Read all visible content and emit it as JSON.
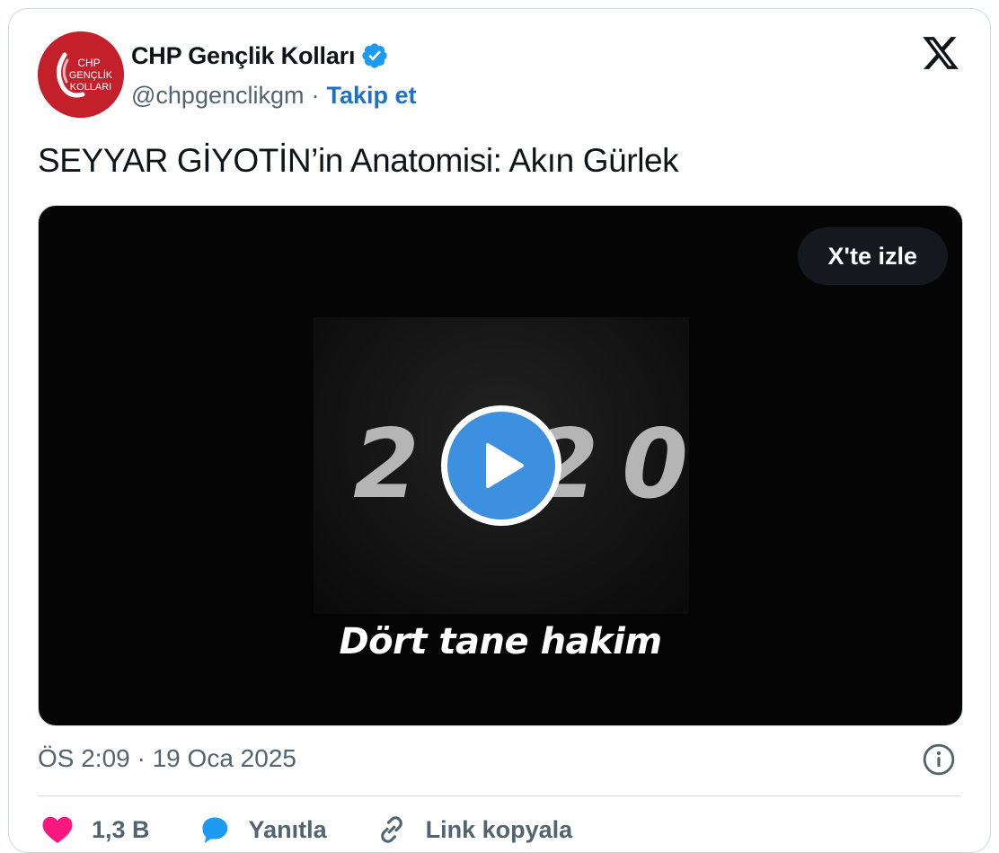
{
  "author": {
    "display_name": "CHP Gençlik Kolları",
    "handle": "@chpgenclikgm",
    "separator": "·",
    "follow_label": "Takip et",
    "avatar_text": [
      "CHP",
      "GENÇLİK",
      "KOLLARI"
    ]
  },
  "tweet": {
    "text": "SEYYAR GİYOTİN’in Anatomisi: Akın Gürlek"
  },
  "video": {
    "watch_label": "X'te izle",
    "frame_year": "2020",
    "frame_caption": "Dört tane hakim"
  },
  "meta": {
    "timestamp": "ÖS 2:09 · 19 Oca 2025"
  },
  "actions": {
    "like_count": "1,3 B",
    "reply_label": "Yanıtla",
    "copy_link_label": "Link kopyala"
  },
  "colors": {
    "brand_blue": "#1d9bf0",
    "follow_blue": "#1d72c8",
    "avatar_red": "#c3202c",
    "like_pink": "#f91880"
  },
  "icons": [
    "verified-badge-icon",
    "x-logo-icon",
    "play-icon",
    "info-icon",
    "heart-icon",
    "reply-bubble-icon",
    "link-icon"
  ]
}
